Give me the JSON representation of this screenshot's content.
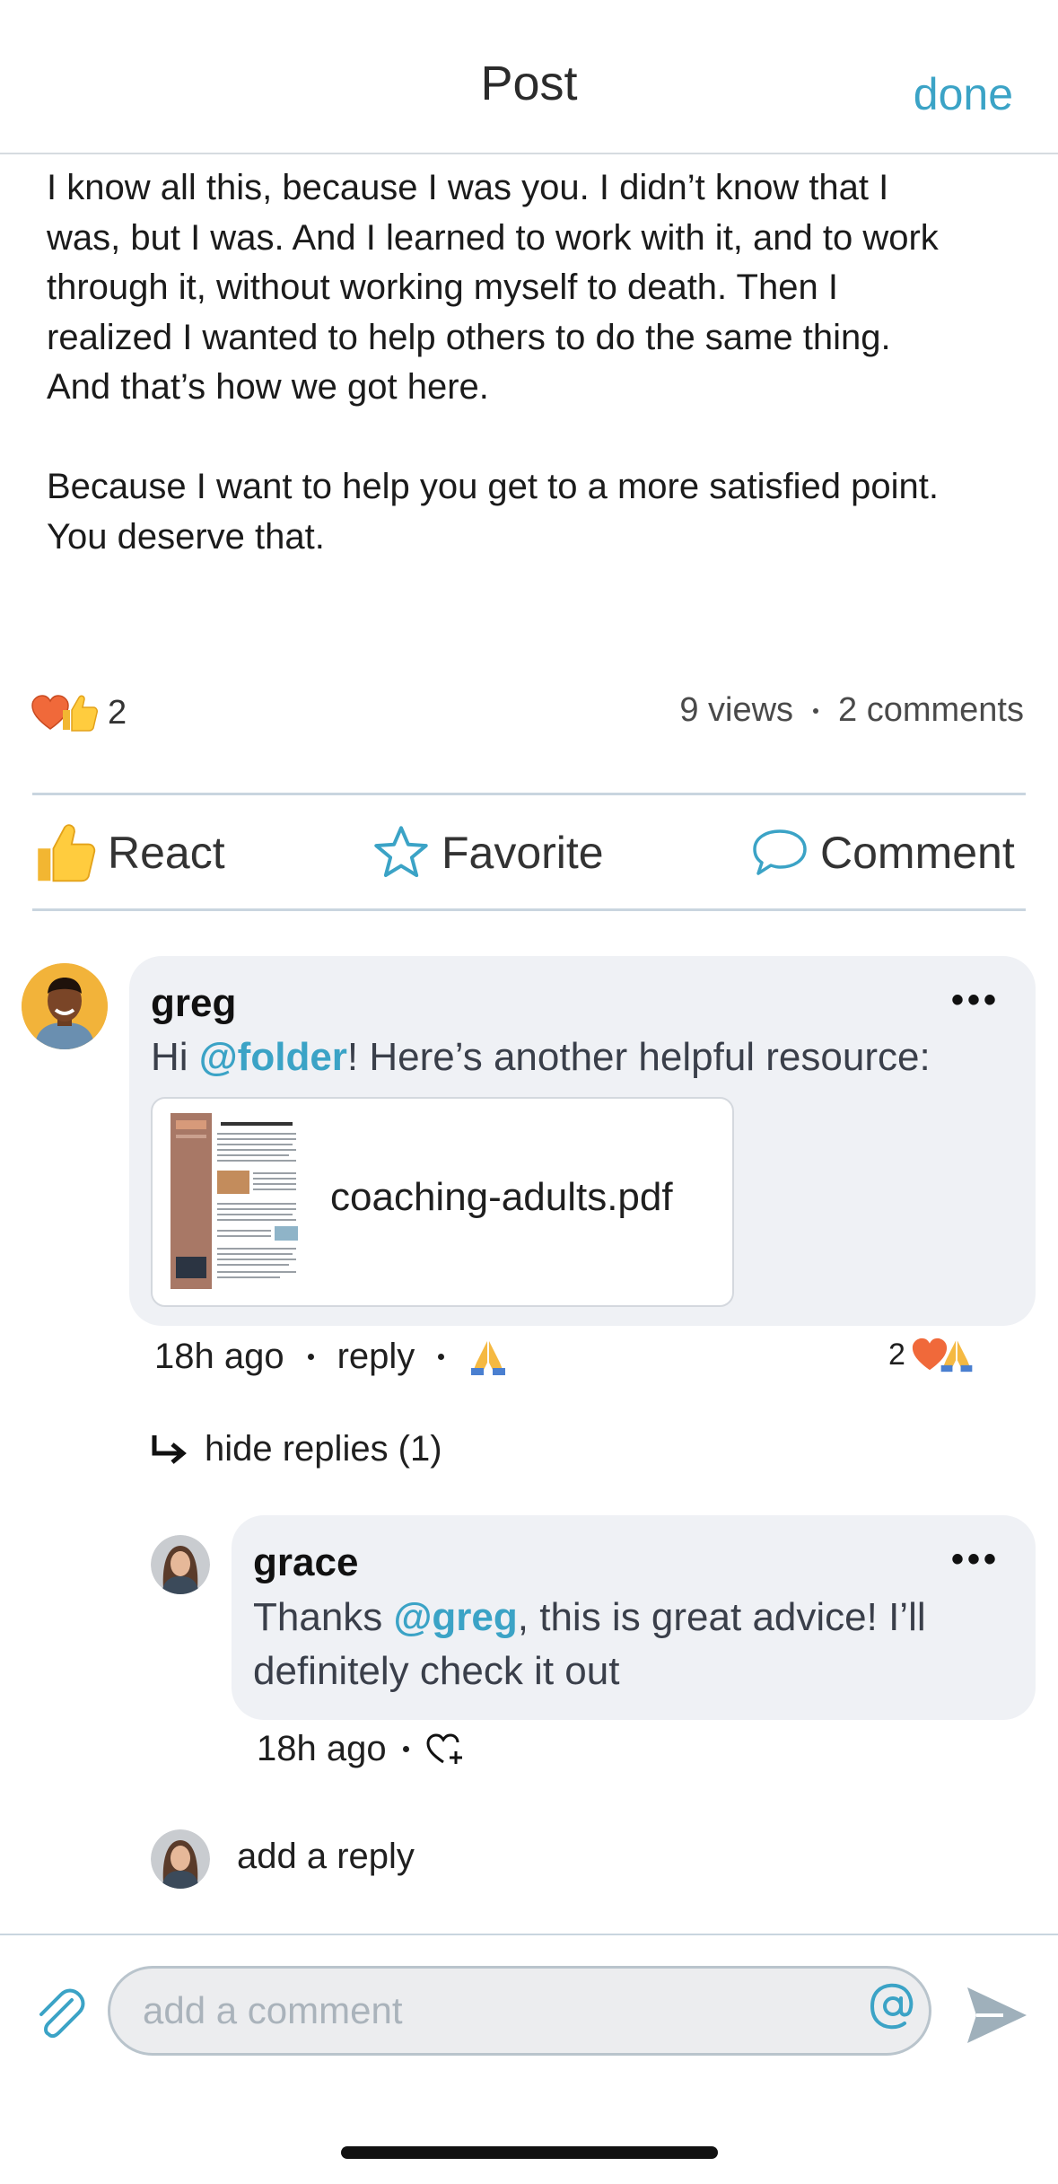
{
  "header": {
    "title": "Post",
    "done_label": "done"
  },
  "post": {
    "body": "I know all this, because I was you. I didn’t know that I\nwas, but I was. And I learned to work with it, and to work\nthrough it, without working myself to death. Then I\nrealized I wanted to help others to do the same thing.\nAnd that’s how we got here.\n\nBecause I want to help you get to a more satisfied point.\nYou deserve that.",
    "reaction_count": "2",
    "views": "9 views",
    "comments": "2 comments"
  },
  "actions": {
    "react": "React",
    "favorite": "Favorite",
    "comment": "Comment"
  },
  "comment": {
    "author": "greg",
    "text_prefix": "Hi ",
    "mention": "@folder",
    "text_suffix": "! Here’s another helpful resource:",
    "attachment_name": "coaching-adults.pdf",
    "time": "18h ago",
    "reply_label": "reply",
    "reaction_count": "2",
    "hide_replies": "hide replies (1)"
  },
  "reply": {
    "author": "grace",
    "text_prefix": "Thanks ",
    "mention": "@greg",
    "text_suffix": ", this is great advice! I’ll definitely check it out",
    "time": "18h ago"
  },
  "add_reply_placeholder": "add a reply",
  "composer": {
    "placeholder": "add a comment"
  },
  "colors": {
    "accent": "#3ba3c6",
    "bubble": "#eff1f5",
    "divider": "#c9d5df"
  }
}
